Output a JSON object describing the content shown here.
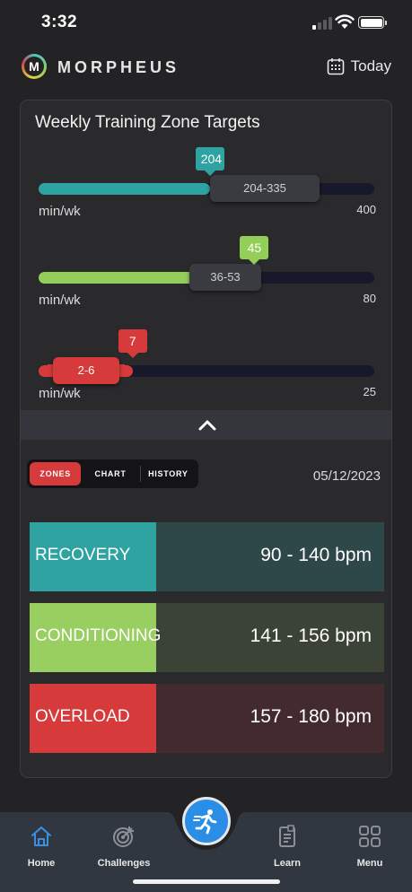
{
  "status": {
    "time": "3:32"
  },
  "header": {
    "brand": "MORPHEUS",
    "logo_letter": "M",
    "today_label": "Today",
    "calendar_icon": "calendar-icon"
  },
  "card": {
    "title": "Weekly Training Zone Targets",
    "sliders": [
      {
        "zone": "recovery",
        "value": "204",
        "range": "204-335",
        "unit": "min/wk",
        "max": "400",
        "value_num": 204,
        "range_min": 204,
        "range_max": 335,
        "max_num": 400,
        "color": "#2fa3a1",
        "range_color": "#3a3b40"
      },
      {
        "zone": "conditioning",
        "value": "45",
        "range": "36-53",
        "unit": "min/wk",
        "max": "80",
        "value_num": 45,
        "range_min": 36,
        "range_max": 53,
        "max_num": 80,
        "color": "#93ce59",
        "range_color": "#3a3b40"
      },
      {
        "zone": "overload",
        "value": "7",
        "range": "2-6",
        "unit": "min/wk",
        "max": "25",
        "value_num": 7,
        "range_min": 2,
        "range_max": 6,
        "max_num": 25,
        "color": "#d63a3a",
        "range_color": "#d63a3a"
      }
    ],
    "collapse_icon": "chevron-up-icon"
  },
  "tabs": {
    "zones": "ZONES",
    "chart": "CHART",
    "history": "HISTORY",
    "active": "zones"
  },
  "date": "05/12/2023",
  "zones": [
    {
      "name": "RECOVERY",
      "bpm": "90 - 140 bpm",
      "color": "#2fa3a1",
      "bg": "#2e4749"
    },
    {
      "name": "CONDITIONING",
      "bpm": "141 - 156 bpm",
      "color": "#98cf60",
      "bg": "#3b4236"
    },
    {
      "name": "OVERLOAD",
      "bpm": "157 - 180 bpm",
      "color": "#d63a3a",
      "bg": "#432a2e"
    }
  ],
  "nav": {
    "home": "Home",
    "challenges": "Challenges",
    "learn": "Learn",
    "menu": "Menu",
    "fab_icon": "running-person-icon"
  }
}
